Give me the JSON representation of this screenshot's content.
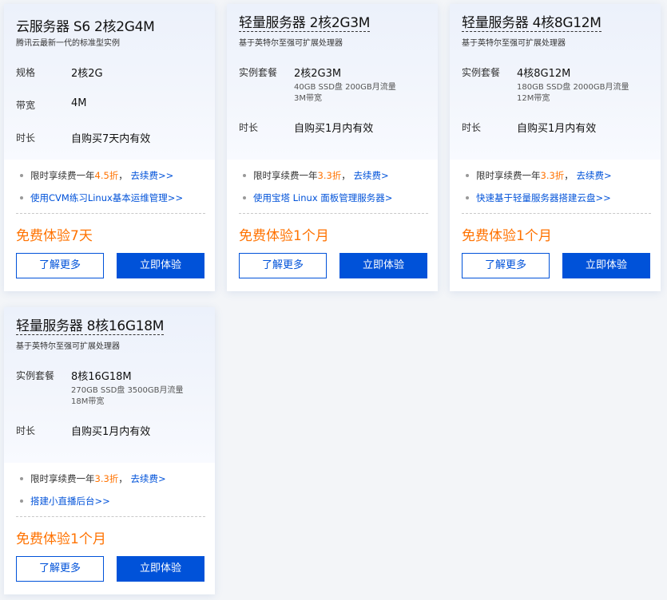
{
  "cards": [
    {
      "title": "云服务器 S6 2核2G4M",
      "subtitle": "腾讯云最新一代的标准型实例",
      "rows": [
        {
          "label": "规格",
          "value": "2核2G"
        },
        {
          "label": "带宽",
          "value": "4M"
        },
        {
          "label": "时长",
          "value": "自购买7天内有效"
        }
      ],
      "bullet1": {
        "prefix": "限时享续费一年",
        "discount": "4.5折",
        "sep": "，",
        "link": "去续费>>"
      },
      "bullet2": {
        "link": "使用CVM练习Linux基本运维管理>>"
      },
      "price": "免费体验7天",
      "learn_more": "了解更多",
      "try_now": "立即体验"
    },
    {
      "title": "轻量服务器 2核2G3M",
      "subtitle": "基于英特尔至强可扩展处理器",
      "package_label": "实例套餐",
      "package_value": "2核2G3M",
      "package_detail_1": "40GB SSD盘 200GB月流量",
      "package_detail_2": "3M带宽",
      "duration_label": "时长",
      "duration_value": "自购买1月内有效",
      "bullet1": {
        "prefix": "限时享续费一年",
        "discount": "3.3折",
        "sep": "，",
        "link": "去续费>"
      },
      "bullet2": {
        "link": "使用宝塔 Linux 面板管理服务器>"
      },
      "price": "免费体验1个月",
      "learn_more": "了解更多",
      "try_now": "立即体验"
    },
    {
      "title": "轻量服务器 4核8G12M",
      "subtitle": "基于英特尔至强可扩展处理器",
      "package_label": "实例套餐",
      "package_value": "4核8G12M",
      "package_detail_1": "180GB SSD盘 2000GB月流量",
      "package_detail_2": "12M带宽",
      "duration_label": "时长",
      "duration_value": "自购买1月内有效",
      "bullet1": {
        "prefix": "限时享续费一年",
        "discount": "3.3折",
        "sep": "，",
        "link": "去续费>"
      },
      "bullet2": {
        "link": "快速基于轻量服务器搭建云盘>>"
      },
      "price": "免费体验1个月",
      "learn_more": "了解更多",
      "try_now": "立即体验"
    },
    {
      "title": "轻量服务器 8核16G18M",
      "subtitle": "基于英特尔至强可扩展处理器",
      "package_label": "实例套餐",
      "package_value": "8核16G18M",
      "package_detail_1": "270GB SSD盘 3500GB月流量",
      "package_detail_2": "18M带宽",
      "duration_label": "时长",
      "duration_value": "自购买1月内有效",
      "bullet1": {
        "prefix": "限时享续费一年",
        "discount": "3.3折",
        "sep": "，",
        "link": "去续费>"
      },
      "bullet2": {
        "link": "搭建小直播后台>>"
      },
      "price": "免费体验1个月",
      "learn_more": "了解更多",
      "try_now": "立即体验"
    }
  ],
  "colors": {
    "accent": "#0052d9",
    "price": "#ff7200"
  }
}
